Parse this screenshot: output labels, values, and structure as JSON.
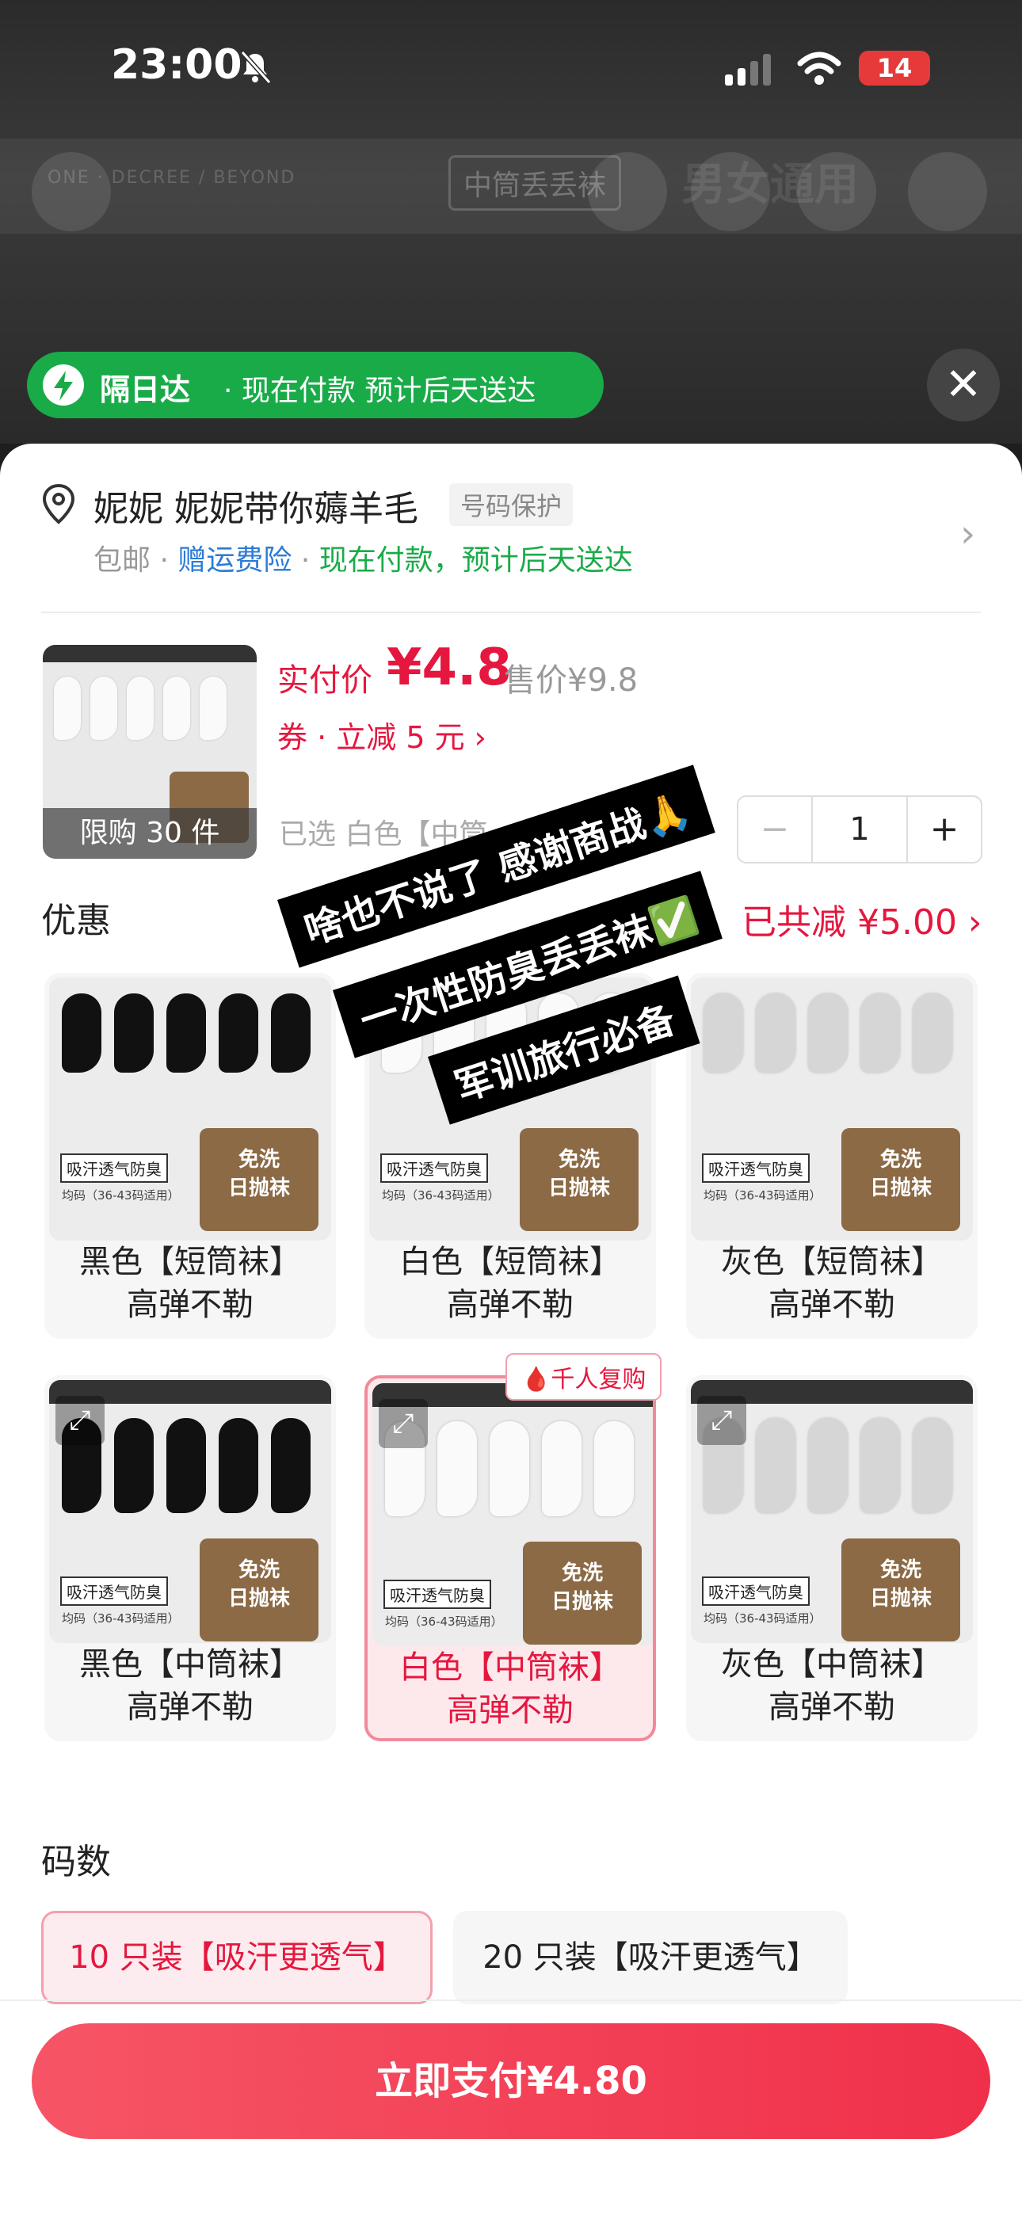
{
  "status": {
    "time": "23:00",
    "battery": "14"
  },
  "background": {
    "brand_text": "ONE · DECREE / BEYOND",
    "tag": "中筒丢丢袜",
    "male_female": "男女通用"
  },
  "delivery": {
    "strong": "隔日达",
    "rest": "· 现在付款 预计后天送达"
  },
  "address": {
    "name": "妮妮  妮妮带你薅羊毛",
    "protect": "号码保护",
    "free_ship": "包邮 · ",
    "insurance": "赠运费险",
    "sep": " · ",
    "arrive": "现在付款，预计后天送达"
  },
  "product": {
    "pay_label": "实付价",
    "pay_price": "¥4.8",
    "orig_price": "售价¥9.8",
    "coupon": "券 · 立减 5 元  ›",
    "limit": "限购 30 件",
    "selected": "已选  白色【中筒",
    "quantity": "1",
    "minus": "−",
    "plus": "+"
  },
  "discount": {
    "title": "优惠",
    "total": "已共减 ¥5.00 ›"
  },
  "captions": [
    "啥也不说了 感谢商战🙏",
    "一次性防臭丢丢袜✅",
    "军训旅行必备"
  ],
  "variants": [
    {
      "line1": "黑色【短筒袜】",
      "line2": "高弹不勒",
      "sock_color": "#111111"
    },
    {
      "line1": "白色【短筒袜】",
      "line2": "高弹不勒",
      "sock_color": "#fafafa"
    },
    {
      "line1": "灰色【短筒袜】",
      "line2": "高弹不勒",
      "sock_color": "#d6d6d6"
    },
    {
      "line1": "黑色【中筒袜】",
      "line2": "高弹不勒",
      "sock_color": "#111111"
    },
    {
      "line1": "白色【中筒袜】",
      "line2": "高弹不勒",
      "sock_color": "#fafafa"
    },
    {
      "line1": "灰色【中筒袜】",
      "line2": "高弹不勒",
      "sock_color": "#d6d6d6"
    }
  ],
  "pack": {
    "line1": "免洗",
    "line2": "日抛袜",
    "tag": "吸汗透气防臭",
    "size": "均码（36-43码适用）"
  },
  "repurchase": "🩸千人复购",
  "size": {
    "title": "码数",
    "opt1": "10 只装【吸汗更透气】",
    "opt2": "20 只装【吸汗更透气】"
  },
  "pay_button": "立即支付¥4.80",
  "colors": {
    "accent": "#e5173f",
    "delivery_green": "#1aab49",
    "link_blue": "#2b7bd6"
  }
}
